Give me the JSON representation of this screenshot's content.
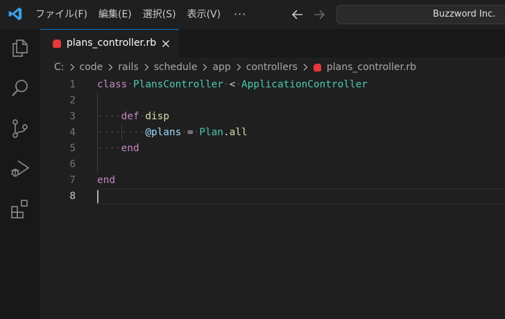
{
  "titlebar": {
    "menu": [
      "ファイル(F)",
      "編集(E)",
      "選択(S)",
      "表示(V)"
    ],
    "more": "···",
    "command_center": "Buzzword Inc."
  },
  "activitybar": {
    "icons": [
      "explorer-icon",
      "search-icon",
      "source-control-icon",
      "run-debug-icon",
      "extensions-icon"
    ]
  },
  "tab": {
    "label": "plans_controller.rb",
    "icon_color": "#e5383b"
  },
  "breadcrumb": {
    "parts": [
      "C:",
      "code",
      "rails",
      "schedule",
      "app",
      "controllers"
    ],
    "file": "plans_controller.rb"
  },
  "editor": {
    "current_line": 8,
    "lines": [
      {
        "n": "1",
        "tokens": [
          [
            "kw",
            "class"
          ],
          [
            "ws",
            "·"
          ],
          [
            "cls",
            "PlansController"
          ],
          [
            "ws",
            "·"
          ],
          [
            "op",
            "<"
          ],
          [
            "ws",
            "·"
          ],
          [
            "cls",
            "ApplicationController"
          ]
        ]
      },
      {
        "n": "2",
        "tokens": []
      },
      {
        "n": "3",
        "tokens": [
          [
            "ws",
            "····"
          ],
          [
            "kw",
            "def"
          ],
          [
            "ws",
            "·"
          ],
          [
            "fn",
            "disp"
          ]
        ]
      },
      {
        "n": "4",
        "tokens": [
          [
            "ws",
            "········"
          ],
          [
            "ivar",
            "@plans"
          ],
          [
            "ws",
            "·"
          ],
          [
            "op",
            "="
          ],
          [
            "ws",
            "·"
          ],
          [
            "cls",
            "Plan"
          ],
          [
            "op",
            "."
          ],
          [
            "fn",
            "all"
          ]
        ]
      },
      {
        "n": "5",
        "tokens": [
          [
            "ws",
            "····"
          ],
          [
            "kw",
            "end"
          ]
        ]
      },
      {
        "n": "6",
        "tokens": []
      },
      {
        "n": "7",
        "tokens": [
          [
            "kw",
            "end"
          ]
        ]
      },
      {
        "n": "8",
        "tokens": []
      }
    ]
  }
}
